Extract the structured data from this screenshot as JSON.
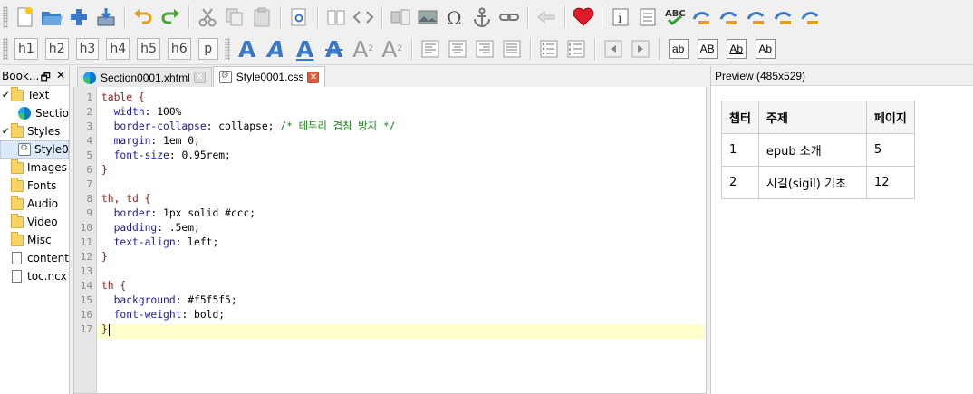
{
  "toolbar": {
    "heading_buttons": [
      "h1",
      "h2",
      "h3",
      "h4",
      "h5",
      "h6",
      "p"
    ],
    "case_buttons": [
      "ab",
      "AB",
      "Ab",
      "Ab"
    ]
  },
  "book_browser": {
    "title": "Book...",
    "items": [
      {
        "label": "Text",
        "type": "folder",
        "checked": true
      },
      {
        "label": "Sectio",
        "type": "xhtml"
      },
      {
        "label": "Styles",
        "type": "folder",
        "checked": true
      },
      {
        "label": "Style0",
        "type": "css",
        "selected": true
      },
      {
        "label": "Images",
        "type": "folder"
      },
      {
        "label": "Fonts",
        "type": "folder"
      },
      {
        "label": "Audio",
        "type": "folder"
      },
      {
        "label": "Video",
        "type": "folder"
      },
      {
        "label": "Misc",
        "type": "folder"
      },
      {
        "label": "content.",
        "type": "file"
      },
      {
        "label": "toc.ncx",
        "type": "file"
      }
    ]
  },
  "tabs": [
    {
      "label": "Section0001.xhtml",
      "active": false
    },
    {
      "label": "Style0001.css",
      "active": true
    }
  ],
  "code_lines": [
    "table {",
    "  width: 100%",
    "  border-collapse: collapse; /* 테두리 겹침 방지 */",
    "  margin: 1em 0;",
    "  font-size: 0.95rem;",
    "}",
    "",
    "th, td {",
    "  border: 1px solid #ccc;",
    "  padding: .5em;",
    "  text-align: left;",
    "}",
    "",
    "th {",
    "  background: #f5f5f5;",
    "  font-weight: bold;",
    "}"
  ],
  "preview": {
    "title": "Preview (485x529)",
    "headers": [
      "챕터",
      "주제",
      "페이지"
    ],
    "rows": [
      [
        "1",
        "epub 소개",
        "5"
      ],
      [
        "2",
        "시길(sigil) 기초",
        "12"
      ]
    ]
  },
  "colors": {
    "accent_blue": "#3a78c8",
    "current_line": "#ffffcc",
    "selector": "#8b1a1a",
    "property": "#1a1aa6",
    "comment": "#178217"
  }
}
